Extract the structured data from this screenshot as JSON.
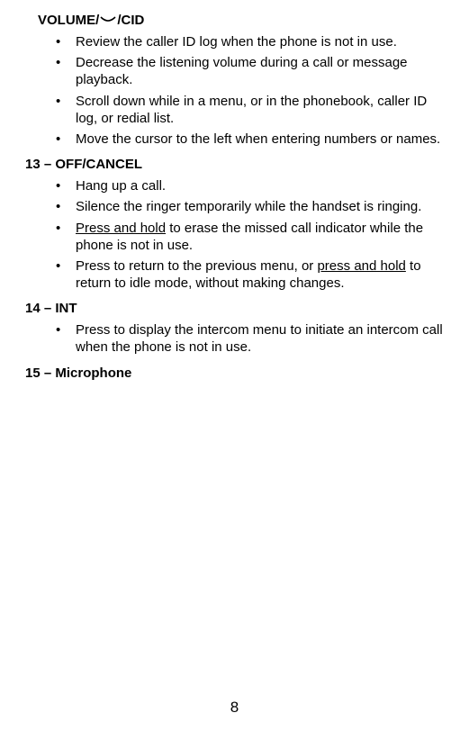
{
  "sections": {
    "volume": {
      "header_pre": "VOLUME/",
      "header_post": "/CID",
      "items": [
        {
          "text": "Review the caller ID log when the phone is not in use."
        },
        {
          "text": "Decrease the listening volume during a call or message playback."
        },
        {
          "text": "Scroll down while in a menu, or in the phonebook, caller ID log, or redial list."
        },
        {
          "text": "Move the cursor to the left when entering numbers or names."
        }
      ]
    },
    "off_cancel": {
      "header": "13 – OFF/CANCEL",
      "items": [
        {
          "text": "Hang up a call."
        },
        {
          "text": "Silence the ringer temporarily while the handset is ringing."
        },
        {
          "u_lead": "Press and hold",
          "text_after": " to erase the missed call indicator while the phone is not in use."
        },
        {
          "text_before": "Press to return to the previous menu, or ",
          "u_mid": "press and hold",
          "text_after2": " to return to idle mode, without making changes."
        }
      ]
    },
    "int": {
      "header": "14 – INT",
      "items": [
        {
          "text": "Press to display the intercom menu to initiate an intercom call when the phone is not in use."
        }
      ]
    },
    "microphone": {
      "header": "15 – Microphone"
    }
  },
  "page_number": "8"
}
